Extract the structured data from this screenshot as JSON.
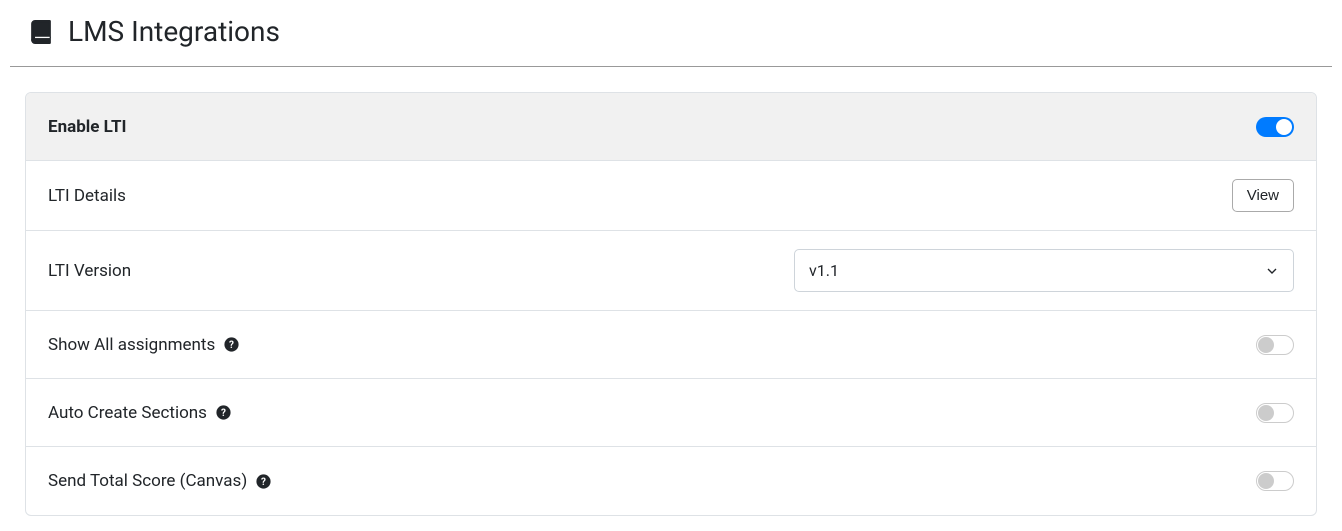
{
  "header": {
    "title": "LMS Integrations"
  },
  "rows": {
    "enable_lti": {
      "label": "Enable LTI",
      "enabled": true
    },
    "lti_details": {
      "label": "LTI Details",
      "button": "View"
    },
    "lti_version": {
      "label": "LTI Version",
      "selected": "v1.1"
    },
    "show_all_assignments": {
      "label": "Show All assignments",
      "enabled": false
    },
    "auto_create_sections": {
      "label": "Auto Create Sections",
      "enabled": false
    },
    "send_total_score": {
      "label": "Send Total Score (Canvas)",
      "enabled": false
    }
  }
}
